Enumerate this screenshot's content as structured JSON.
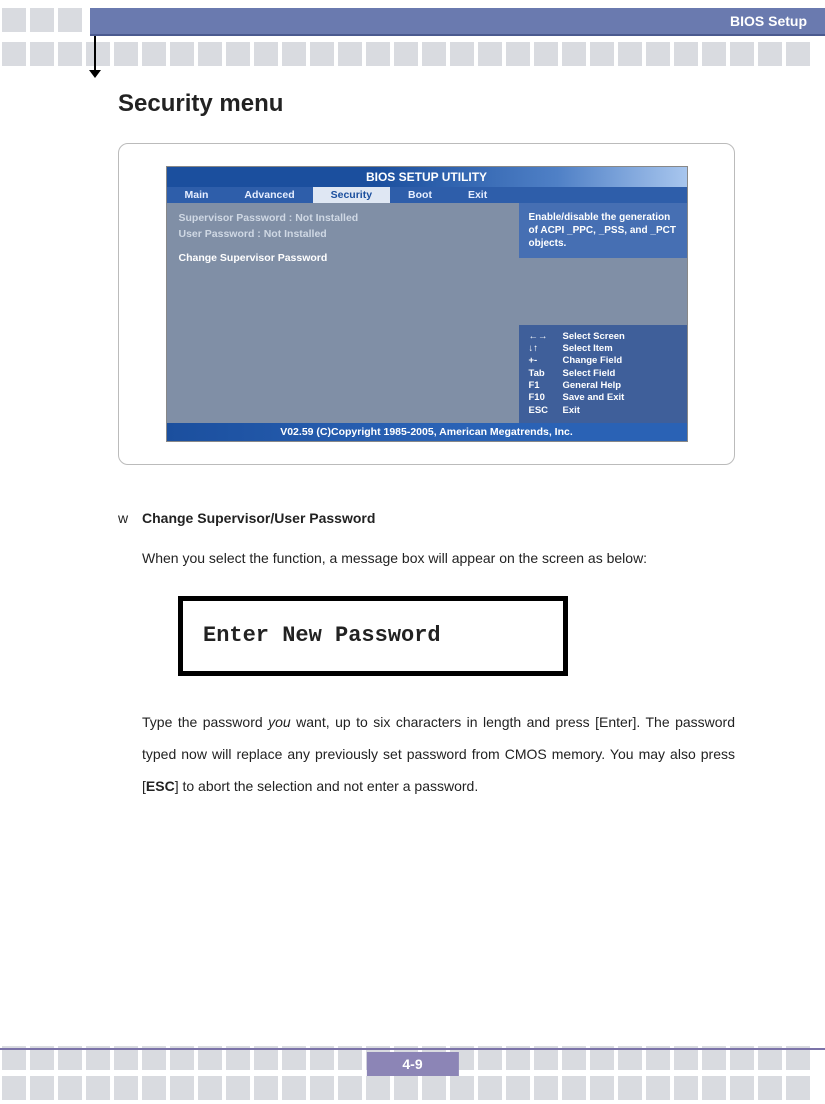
{
  "header": {
    "title": "BIOS Setup"
  },
  "page": {
    "heading": "Security menu"
  },
  "bios": {
    "title": "BIOS SETUP UTILITY",
    "tabs": [
      "Main",
      "Advanced",
      "Security",
      "Boot",
      "Exit"
    ],
    "left": {
      "line1": "Supervisor Password  : Not Installed",
      "line2": "User Password        : Not Installed",
      "change": "Change Supervisor Password"
    },
    "help_text": "Enable/disable the generation of ACPI _PPC, _PSS, and _PCT objects.",
    "keys": [
      {
        "k": "←→",
        "label": "Select Screen"
      },
      {
        "k": "↓↑",
        "label": "Select Item"
      },
      {
        "k": "+-",
        "label": "Change Field"
      },
      {
        "k": "Tab",
        "label": "Select Field"
      },
      {
        "k": "F1",
        "label": "General Help"
      },
      {
        "k": "F10",
        "label": "Save and Exit"
      },
      {
        "k": "ESC",
        "label": "Exit"
      }
    ],
    "footer": "V02.59 (C)Copyright 1985-2005, American Megatrends, Inc."
  },
  "section": {
    "bullet": "w",
    "item_title": "Change Supervisor/User Password",
    "para1": "When you select the function, a message box will appear on the screen as below:",
    "password_prompt": "Enter New Password",
    "para2_pre": "Type the password ",
    "para2_you": "you",
    "para2_mid": " want, up to six characters in length and press [Enter].   The password typed now will replace any previously set password from CMOS memory. You may also press [",
    "para2_esc": "ESC",
    "para2_post": "] to abort the selection and not enter a password."
  },
  "page_number": "4-9"
}
